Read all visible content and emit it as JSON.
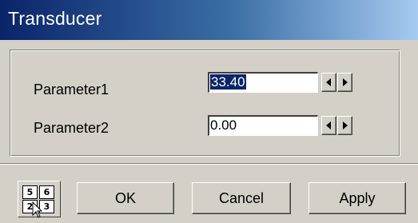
{
  "window": {
    "title": "Transducer"
  },
  "params": [
    {
      "label": "Parameter1",
      "value": "33.40",
      "selected": true
    },
    {
      "label": "Parameter2",
      "value": "0.00",
      "selected": false
    }
  ],
  "calculator": {
    "keys": [
      "5",
      "6",
      "2",
      "3"
    ],
    "icon": "calculator-keypad-icon"
  },
  "buttons": {
    "ok": "OK",
    "cancel": "Cancel",
    "apply": "Apply"
  },
  "colors": {
    "titlebar_start": "#0a246a",
    "titlebar_end": "#a6caf0",
    "face": "#d4d0c8",
    "selection": "#0a246a"
  }
}
